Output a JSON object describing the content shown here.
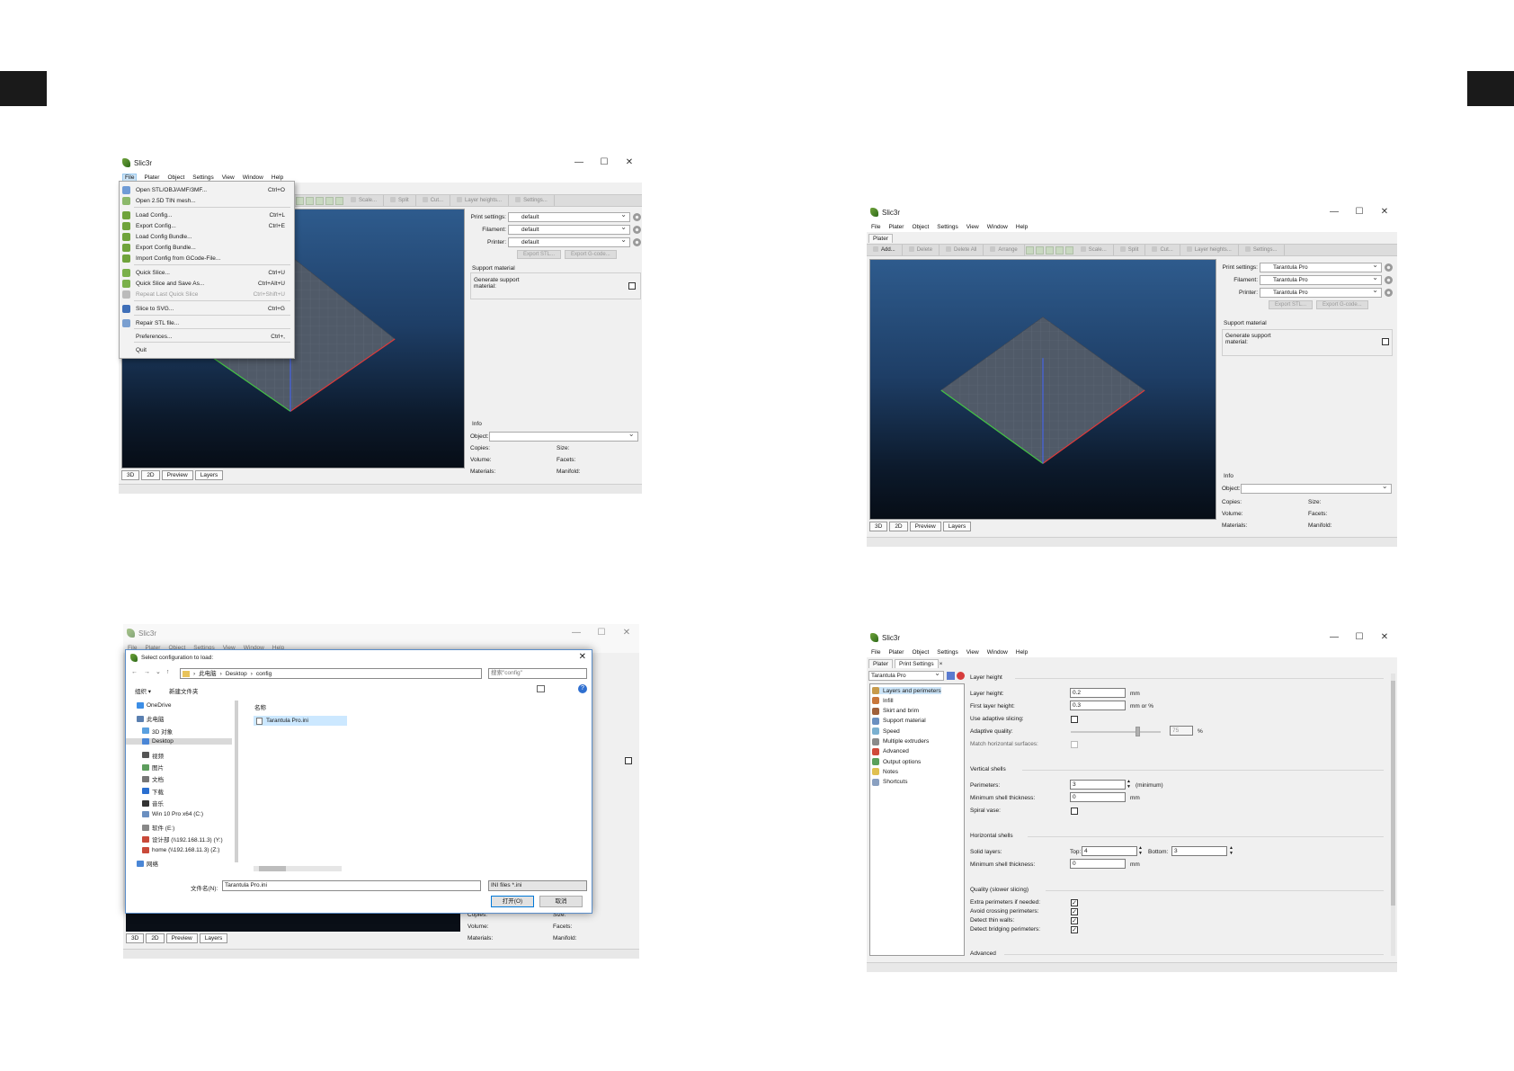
{
  "app_title": "Slic3r",
  "menu_bar": [
    "File",
    "Plater",
    "Object",
    "Settings",
    "View",
    "Window",
    "Help"
  ],
  "window_controls": {
    "minimize": "—",
    "maximize": "☐",
    "close": "✕"
  },
  "plater_tab": "Plater",
  "print_settings_tab": "Print Settings",
  "view_tabs": [
    "3D",
    "2D",
    "Preview",
    "Layers"
  ],
  "right_panel": {
    "print_settings_label": "Print settings:",
    "filament_label": "Filament:",
    "printer_label": "Printer:",
    "export_stl": "Export STL...",
    "export_gcode": "Export G-code...",
    "support_section": "Support material",
    "generate_support": "Generate support material:",
    "info": "Info",
    "object_label": "Object:",
    "copies": "Copies:",
    "size": "Size:",
    "volume": "Volume:",
    "facets": "Facets:",
    "materials": "Materials:",
    "manifold": "Manifold:"
  },
  "panel1": {
    "toolbar": [
      "Scale...",
      "Split",
      "Cut...",
      "Layer heights...",
      "Settings..."
    ],
    "print_settings_value": "default",
    "filament_value": "default",
    "printer_value": "default",
    "file_menu": [
      {
        "label": "Open STL/OBJ/AMF/3MF...",
        "key": "Ctrl+O",
        "enabled": true
      },
      {
        "label": "Open 2.5D TIN mesh...",
        "key": "",
        "enabled": true
      },
      {
        "label": "Load Config...",
        "key": "Ctrl+L",
        "enabled": true
      },
      {
        "label": "Export Config...",
        "key": "Ctrl+E",
        "enabled": true
      },
      {
        "label": "Load Config Bundle...",
        "key": "",
        "enabled": true
      },
      {
        "label": "Export Config Bundle...",
        "key": "",
        "enabled": true
      },
      {
        "label": "Import Config from GCode-File...",
        "key": "",
        "enabled": true
      },
      {
        "label": "Quick Slice...",
        "key": "Ctrl+U",
        "enabled": true
      },
      {
        "label": "Quick Slice and Save As...",
        "key": "Ctrl+Alt+U",
        "enabled": true
      },
      {
        "label": "Repeat Last Quick Slice",
        "key": "Ctrl+Shift+U",
        "enabled": false
      },
      {
        "label": "Slice to SVG...",
        "key": "Ctrl+G",
        "enabled": true
      },
      {
        "label": "Repair STL file...",
        "key": "",
        "enabled": true
      },
      {
        "label": "Preferences...",
        "key": "Ctrl+,",
        "enabled": true
      },
      {
        "label": "Quit",
        "key": "",
        "enabled": true
      }
    ]
  },
  "panel2": {
    "toolbar": [
      "Add...",
      "Delete",
      "Delete All",
      "Arrange",
      "Scale...",
      "Split",
      "Cut...",
      "Layer heights...",
      "Settings..."
    ],
    "print_settings_value": "Tarantula Pro",
    "filament_value": "Tarantula Pro",
    "printer_value": "Tarantula Pro"
  },
  "panel3": {
    "dialog_title": "Select configuration to load:",
    "breadcrumb": [
      "此电脑",
      "Desktop",
      "config"
    ],
    "search_placeholder": "搜索\"config\"",
    "organize": "组织 ▾",
    "new_folder": "新建文件夹",
    "column_name": "名称",
    "nav": [
      "OneDrive",
      "此电脑",
      "3D 对象",
      "Desktop",
      "视频",
      "图片",
      "文档",
      "下载",
      "音乐",
      "Win 10 Pro x64 (C:)",
      "软件 (E:)",
      "设计部 (\\\\192.168.11.3) (Y:)",
      "home (\\\\192.168.11.3) (Z:)",
      "网络"
    ],
    "file": "Tarantula Pro.ini",
    "filename_label": "文件名(N):",
    "filename_value": "Tarantula Pro.ini",
    "filetype": "INI files *.ini",
    "open_btn": "打开(O)",
    "cancel_btn": "取消"
  },
  "panel4": {
    "preset": "Tarantula Pro",
    "tree": [
      "Layers and perimeters",
      "Infill",
      "Skirt and brim",
      "Support material",
      "Speed",
      "Multiple extruders",
      "Advanced",
      "Output options",
      "Notes",
      "Shortcuts"
    ],
    "groups": {
      "layer_height": "Layer height",
      "vertical_shells": "Vertical shells",
      "horizontal_shells": "Horizontal shells",
      "quality": "Quality (slower slicing)",
      "advanced": "Advanced"
    },
    "layer_height_label": "Layer height:",
    "layer_height_value": "0.2",
    "first_layer_label": "First layer height:",
    "first_layer_value": "0.3",
    "mm": "mm",
    "mm_or_pct": "mm or %",
    "adaptive_slicing": "Use adaptive slicing:",
    "adaptive_quality": "Adaptive quality:",
    "adaptive_value": "75",
    "pct": "%",
    "match_horizontal": "Match horizontal surfaces:",
    "perimeters_label": "Perimeters:",
    "perimeters_value": "3",
    "minimum": "(minimum)",
    "min_shell_label": "Minimum shell thickness:",
    "min_shell_value": "0",
    "spiral_vase": "Spiral vase:",
    "solid_layers": "Solid layers:",
    "top_label": "Top:",
    "top_value": "4",
    "bottom_label": "Bottom:",
    "bottom_value": "3",
    "min_shell_h_value": "0",
    "extra_perimeters": "Extra perimeters if needed:",
    "avoid_crossing": "Avoid crossing perimeters:",
    "detect_thin": "Detect thin walls:",
    "detect_bridging": "Detect bridging perimeters:"
  }
}
